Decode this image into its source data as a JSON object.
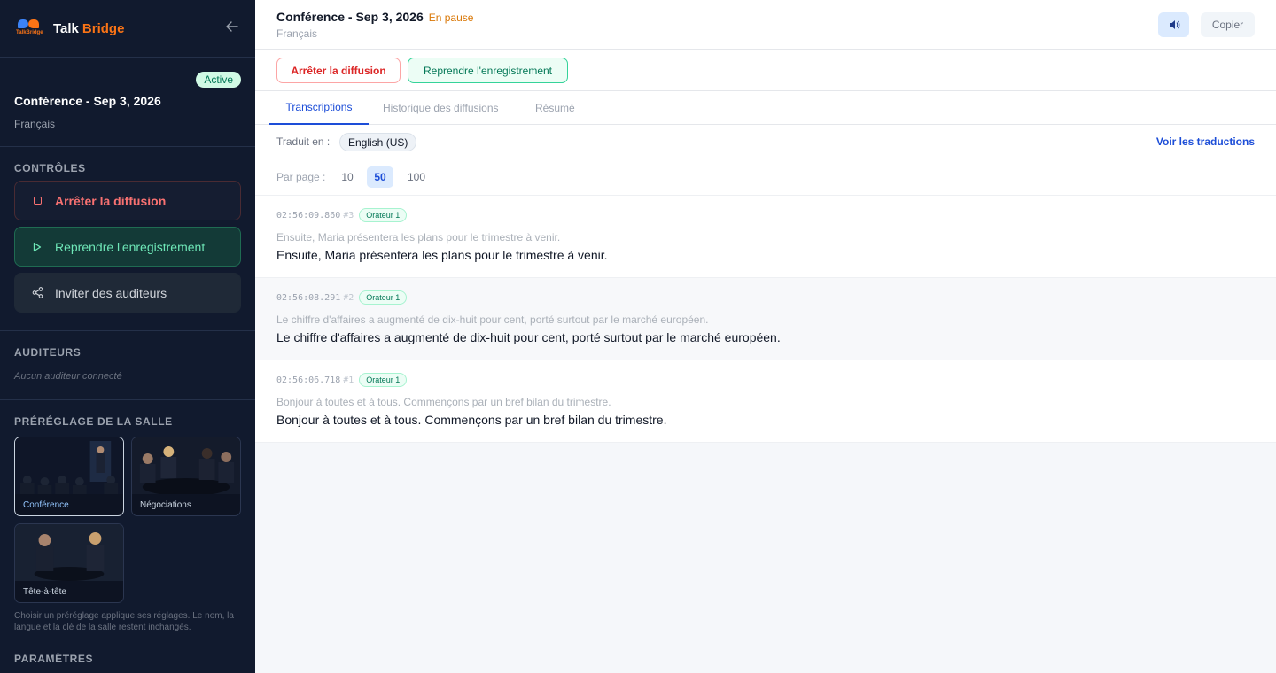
{
  "app": {
    "logo_text": "TalkBridge",
    "name_first": "Talk",
    "name_second": "Bridge",
    "collapse_icon": "arrow-left-icon"
  },
  "sidebar": {
    "session": {
      "badge": "Active",
      "title": "Conférence - Sep 3, 2026",
      "language": "Français"
    },
    "controls": {
      "title": "CONTRÔLES",
      "stop_label": "Arrêter la diffusion",
      "resume_label": "Reprendre l'enregistrement",
      "invite_label": "Inviter des auditeurs"
    },
    "listeners": {
      "title": "AUDITEURS",
      "empty": "Aucun auditeur connecté"
    },
    "presets": {
      "title": "PRÉRÉGLAGE DE LA SALLE",
      "items": [
        {
          "label": "Conférence",
          "selected": true
        },
        {
          "label": "Négociations",
          "selected": false
        },
        {
          "label": "Tête-à-tête",
          "selected": false
        }
      ],
      "note": "Choisir un préréglage applique ses réglages. Le nom, la langue et la clé de la salle restent inchangés."
    },
    "settings_title": "PARAMÈTRES"
  },
  "header": {
    "title": "Conférence - Sep 3, 2026",
    "status": "En pause",
    "language": "Français",
    "speaker_icon": "speaker-icon",
    "copy_label": "Copier"
  },
  "actions": {
    "stop_label": "Arrêter la diffusion",
    "resume_label": "Reprendre l'enregistrement"
  },
  "tabs": [
    {
      "label": "Transcriptions",
      "active": true
    },
    {
      "label": "Historique des diffusions",
      "active": false
    },
    {
      "label": "Résumé",
      "active": false
    }
  ],
  "translation": {
    "label": "Traduit en :",
    "language": "English (US)",
    "link": "Voir les traductions"
  },
  "pagination": {
    "label": "Par page :",
    "options": [
      "10",
      "50",
      "100"
    ],
    "selected": "50"
  },
  "segments": [
    {
      "time": "02:56:09.860",
      "num": "#3",
      "speaker": "Orateur 1",
      "original": "Ensuite, Maria présentera les plans pour le trimestre à venir.",
      "translation": "Ensuite, Maria présentera les plans pour le trimestre à venir."
    },
    {
      "time": "02:56:08.291",
      "num": "#2",
      "speaker": "Orateur 1",
      "original": "Le chiffre d'affaires a augmenté de dix-huit pour cent, porté surtout par le marché européen.",
      "translation": "Le chiffre d'affaires a augmenté de dix-huit pour cent, porté surtout par le marché européen."
    },
    {
      "time": "02:56:06.718",
      "num": "#1",
      "speaker": "Orateur 1",
      "original": "Bonjour à toutes et à tous. Commençons par un bref bilan du trimestre.",
      "translation": "Bonjour à toutes et à tous. Commençons par un bref bilan du trimestre."
    }
  ],
  "colors": {
    "sidebar_bg": "#111a2e",
    "accent": "#f97316",
    "primary": "#1d4ed8",
    "danger": "#dc2626",
    "success": "#047857",
    "paused": "#d97706"
  }
}
